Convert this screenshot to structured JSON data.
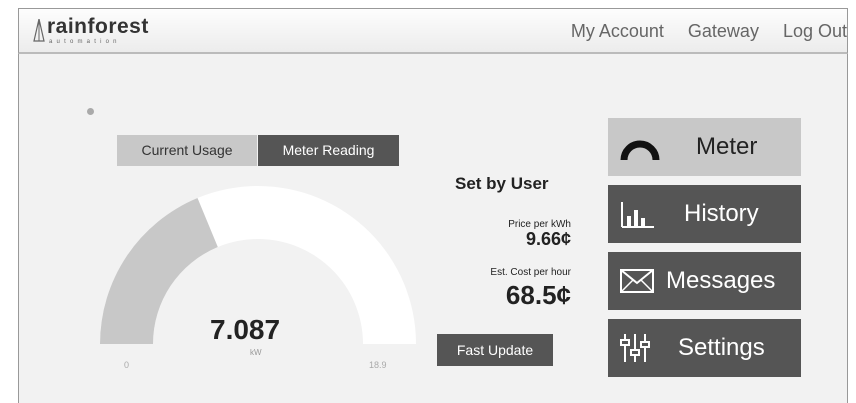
{
  "brand": {
    "name": "rainforest",
    "tagline": "automation"
  },
  "nav": {
    "my_account": "My Account",
    "gateway": "Gateway",
    "logout": "Log Out"
  },
  "tabs": {
    "current_usage": "Current Usage",
    "meter_reading": "Meter Reading"
  },
  "gauge": {
    "value": "7.087",
    "unit": "kW",
    "min": "0",
    "max": "18.9",
    "fill_fraction": 0.375
  },
  "pricing": {
    "heading": "Set by User",
    "price_label": "Price per kWh",
    "price_value": "9.66¢",
    "cost_label": "Est. Cost per hour",
    "cost_value": "68.5¢",
    "fast_update": "Fast Update"
  },
  "menu": [
    {
      "label": "Meter",
      "icon": "meter-icon",
      "active": true
    },
    {
      "label": "History",
      "icon": "bar-chart-icon",
      "active": false
    },
    {
      "label": "Messages",
      "icon": "envelope-icon",
      "active": false
    },
    {
      "label": "Settings",
      "icon": "sliders-icon",
      "active": false
    }
  ],
  "colors": {
    "dark_button": "#555555",
    "light_button": "#c8c8c8",
    "gauge_fill": "#c8c8c8"
  }
}
